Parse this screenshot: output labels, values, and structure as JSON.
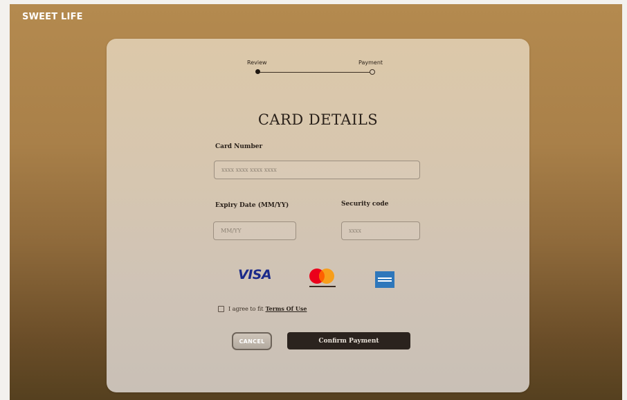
{
  "brand": "SWEET LIFE",
  "steps": {
    "review": "Review",
    "payment": "Payment",
    "current_step": 1,
    "total_steps": 2
  },
  "form": {
    "title": "CARD DETAILS",
    "card_number": {
      "label": "Card Number",
      "placeholder": "xxxx xxxx xxxx xxxx"
    },
    "expiry": {
      "label": "Expiry Date (MM/YY)",
      "placeholder": "MM/YY"
    },
    "security": {
      "label": "Security code",
      "placeholder": "xxxx"
    }
  },
  "payment_methods": {
    "visa": "VISA"
  },
  "agree": {
    "text": "I agree to fit",
    "terms_link": "Terms Of Use",
    "checked": false
  },
  "buttons": {
    "cancel": "CANCEL",
    "confirm": "Confirm Payment"
  },
  "colors": {
    "background_top": "#b48a4f",
    "background_bottom": "#55401f",
    "card_bg": "#d6c6b0",
    "confirm_button": "#2b231e",
    "visa_blue": "#1b2a8a",
    "mastercard_red": "#eb001b",
    "mastercard_orange": "#f79e1b",
    "amex_blue": "#2e77bb"
  }
}
